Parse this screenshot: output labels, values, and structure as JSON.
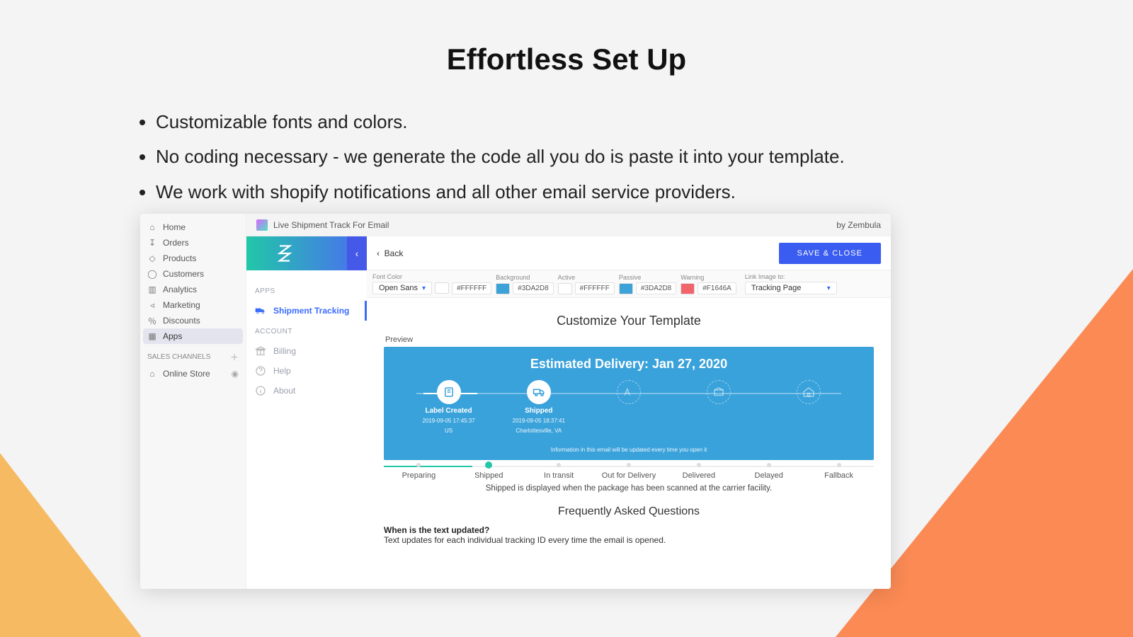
{
  "hero": {
    "title": "Effortless Set Up",
    "bullets": [
      "Customizable fonts and colors.",
      "No coding necessary - we generate the code all you do is paste it into your template.",
      "We work with shopify notifications and all other email service providers."
    ]
  },
  "titlebar": {
    "app_name": "Live Shipment Track For Email",
    "by": "by Zembula"
  },
  "shop_sidebar": {
    "items": [
      {
        "label": "Home"
      },
      {
        "label": "Orders"
      },
      {
        "label": "Products"
      },
      {
        "label": "Customers"
      },
      {
        "label": "Analytics"
      },
      {
        "label": "Marketing"
      },
      {
        "label": "Discounts"
      },
      {
        "label": "Apps"
      }
    ],
    "section": "SALES CHANNELS",
    "channels": [
      {
        "label": "Online Store"
      }
    ]
  },
  "appnav": {
    "groups": [
      {
        "heading": "APPS",
        "items": [
          {
            "label": "Shipment Tracking"
          }
        ]
      },
      {
        "heading": "ACCOUNT",
        "items": [
          {
            "label": "Billing"
          },
          {
            "label": "Help"
          },
          {
            "label": "About"
          }
        ]
      }
    ]
  },
  "mainbar": {
    "back": "Back",
    "save": "SAVE & CLOSE"
  },
  "toolbar": {
    "font_label": "Font Color",
    "font_name": "Open Sans",
    "font_hex": "#FFFFFF",
    "cells": [
      {
        "label": "Background",
        "hex": "#3DA2D8",
        "color": "#3DA2D8"
      },
      {
        "label": "Active",
        "hex": "#FFFFFF",
        "color": "#FFFFFF"
      },
      {
        "label": "Passive",
        "hex": "#3DA2D8",
        "color": "#3DA2D8"
      },
      {
        "label": "Warning",
        "hex": "#F1646A",
        "color": "#F1646A"
      }
    ],
    "link_label": "Link Image to:",
    "link_value": "Tracking Page"
  },
  "content": {
    "heading": "Customize Your Template",
    "preview_label": "Preview",
    "banner": {
      "headline": "Estimated Delivery: Jan 27, 2020",
      "steps": [
        {
          "name": "Label Created",
          "meta1": "2019-09-05 17:45:37",
          "meta2": "US"
        },
        {
          "name": "Shipped",
          "meta1": "2019-09-05 18:37:41",
          "meta2": "Charlottesville, VA"
        },
        {
          "name": "",
          "meta1": "",
          "meta2": ""
        },
        {
          "name": "",
          "meta1": "",
          "meta2": ""
        },
        {
          "name": "",
          "meta1": "",
          "meta2": ""
        }
      ],
      "note": "Information in this email will be updated every time you open it"
    },
    "tabs": [
      "Preparing",
      "Shipped",
      "In transit",
      "Out for Delivery",
      "Delivered",
      "Delayed",
      "Fallback"
    ],
    "active_tab_index": 1,
    "desc": "Shipped is displayed when the package has been scanned at the carrier facility.",
    "faq": {
      "heading": "Frequently Asked Questions",
      "q": "When is the text updated?",
      "a": "Text updates for each individual tracking ID every time the email is opened."
    }
  }
}
